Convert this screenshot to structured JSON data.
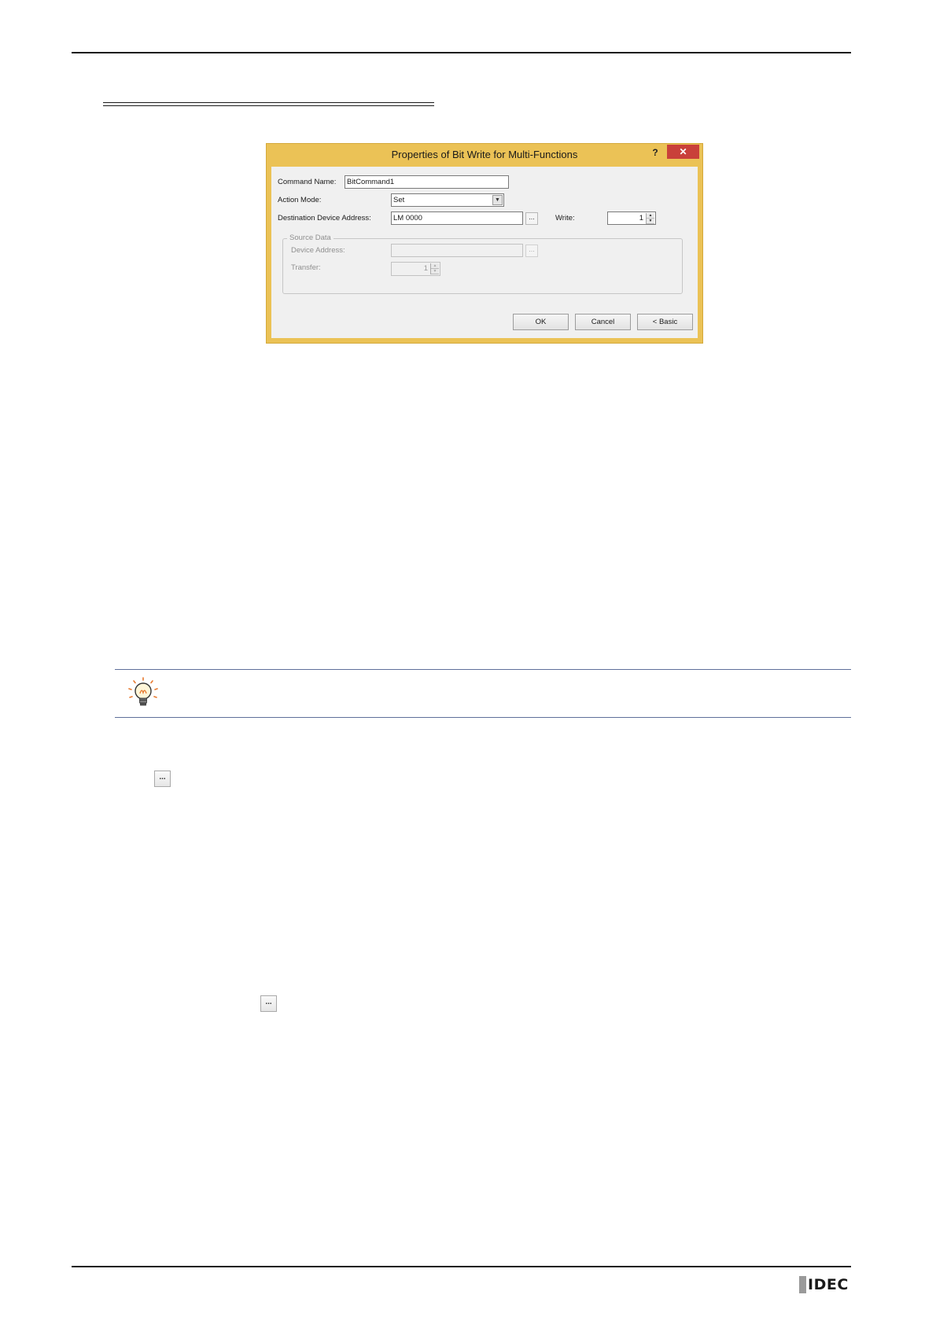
{
  "dialog": {
    "title": "Properties of Bit Write for Multi-Functions",
    "help_label": "?",
    "close_label": "✕",
    "command_name": {
      "label": "Command Name:",
      "value": "BitCommand1"
    },
    "action_mode": {
      "label": "Action Mode:",
      "value": "Set"
    },
    "destination_device_address": {
      "label": "Destination Device Address:",
      "value": "LM 0000",
      "browse_label": "..."
    },
    "write": {
      "label": "Write:",
      "value": "1"
    },
    "source_data": {
      "legend": "Source Data",
      "device_address": {
        "label": "Device Address:",
        "value": "",
        "browse_label": "..."
      },
      "transfer": {
        "label": "Transfer:",
        "value": "1"
      }
    },
    "buttons": {
      "ok": "OK",
      "cancel": "Cancel",
      "basic": "< Basic"
    }
  },
  "inline_buttons": {
    "browse_1": "...",
    "browse_2": "..."
  },
  "footer": {
    "logo_text": "IDEC"
  },
  "colors": {
    "titlebar": "#ebc256",
    "close_button": "#c9403a",
    "hint_rule": "#5f6f9a",
    "logo_bar": "#9a9a9a"
  }
}
